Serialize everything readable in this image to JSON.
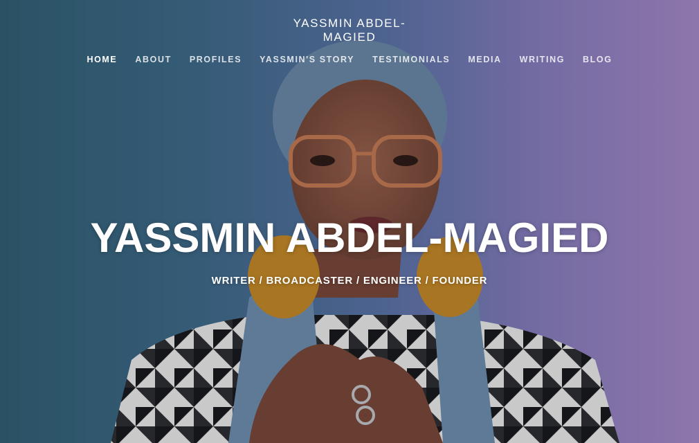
{
  "header": {
    "site_title": "YASSMIN ABDEL-\nMAGIED",
    "nav": [
      {
        "label": "HOME",
        "active": true
      },
      {
        "label": "ABOUT",
        "active": false
      },
      {
        "label": "PROFILES",
        "active": false
      },
      {
        "label": "YASSMIN'S STORY",
        "active": false
      },
      {
        "label": "TESTIMONIALS",
        "active": false
      },
      {
        "label": "MEDIA",
        "active": false
      },
      {
        "label": "WRITING",
        "active": false
      },
      {
        "label": "BLOG",
        "active": false
      }
    ]
  },
  "hero": {
    "heading": "YASSMIN ABDEL-MAGIED",
    "subtitle": "WRITER / BROADCASTER / ENGINEER / FOUNDER",
    "colors": {
      "background_left": "#2f5f70",
      "background_right": "#a88ac6",
      "text": "#ffffff"
    }
  }
}
